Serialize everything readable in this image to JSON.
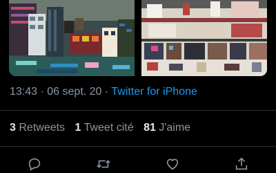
{
  "tweet": {
    "media": [
      {
        "icon": "photo-lego-city-skyline"
      },
      {
        "icon": "photo-lego-japanese-shops"
      }
    ],
    "time": "13:43",
    "separator": "·",
    "date": "06 sept. 20",
    "source": "Twitter for iPhone"
  },
  "stats": {
    "retweets_count": "3",
    "retweets_label": "Retweets",
    "quotes_count": "1",
    "quotes_label": "Tweet cité",
    "likes_count": "81",
    "likes_label": "J'aime"
  },
  "actions": [
    {
      "icon": "reply-icon"
    },
    {
      "icon": "retweet-icon"
    },
    {
      "icon": "like-icon"
    },
    {
      "icon": "share-icon"
    }
  ],
  "colors": {
    "background": "#000000",
    "text_primary": "#e7e9ea",
    "text_secondary": "#8b98a5",
    "link": "#1d9bf0",
    "divider": "#2f3336"
  }
}
